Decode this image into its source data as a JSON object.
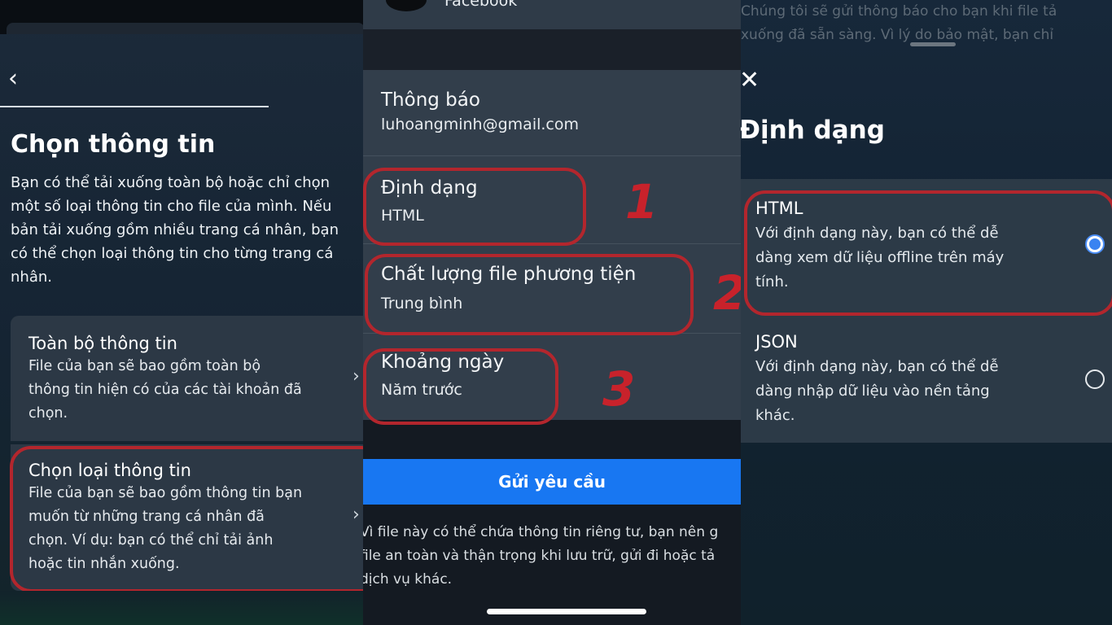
{
  "colors": {
    "highlight": "#b3262d",
    "accent": "#1877f2",
    "radio_selected": "#3a83f1"
  },
  "left_panel": {
    "back_icon": "chevron-left-icon",
    "title": "Chọn thông tin",
    "description_lines": [
      "Bạn có thể tải xuống toàn bộ hoặc chỉ chọn",
      "một số loại thông tin cho file của mình. Nếu",
      "bản tải xuống gồm nhiều trang cá nhân, bạn",
      "có thể chọn loại thông tin cho từng trang cá",
      "nhân."
    ],
    "options": [
      {
        "title": "Toàn bộ thông tin",
        "lines": [
          "File của bạn sẽ bao gồm toàn bộ",
          "thông tin hiện có của các tài khoản đã",
          "chọn."
        ],
        "chevron": "›"
      },
      {
        "title": "Chọn loại thông tin",
        "lines": [
          "File của bạn sẽ bao gồm thông tin bạn",
          "muốn từ những trang cá nhân đã",
          "chọn. Ví dụ: bạn có thể chỉ tải ảnh",
          "hoặc tin nhắn xuống."
        ],
        "chevron": "›"
      }
    ]
  },
  "middle_panel": {
    "account_name": "Facebook",
    "settings": [
      {
        "label": "Thông báo",
        "value": "luhoangminh@gmail.com"
      },
      {
        "label": "Định dạng",
        "value": "HTML"
      },
      {
        "label": "Chất lượng file phương tiện",
        "value": "Trung bình"
      },
      {
        "label": "Khoảng ngày",
        "value": "Năm trước"
      }
    ],
    "annotations": [
      "1",
      "2",
      "3"
    ],
    "submit_label": "Gửi yêu cầu",
    "note_lines": [
      "Vì file này có thể chứa thông tin riêng tư, bạn nên g",
      "file an toàn và thận trọng khi lưu trữ, gửi đi hoặc tả",
      "dịch vụ khác."
    ]
  },
  "right_panel": {
    "background_lines": [
      "Chúng tôi sẽ gửi thông báo cho bạn khi file tả",
      "xuống đã sẵn sàng. Vì lý do bảo mật, bạn chỉ"
    ],
    "close_icon": "close-icon",
    "title": "Định dạng",
    "formats": [
      {
        "name": "HTML",
        "lines": [
          "Với định dạng này, bạn có thể dễ",
          "dàng xem dữ liệu offline trên máy",
          "tính."
        ],
        "selected": true
      },
      {
        "name": "JSON",
        "lines": [
          "Với định dạng này, bạn có thể dễ",
          "dàng nhập dữ liệu vào nền tảng",
          "khác."
        ],
        "selected": false
      }
    ]
  }
}
